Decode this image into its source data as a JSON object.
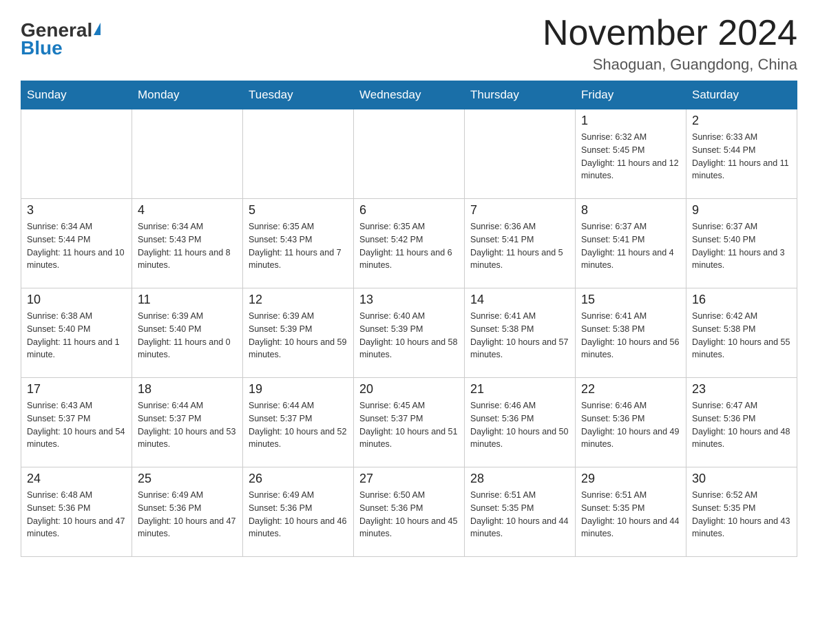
{
  "header": {
    "logo_general": "General",
    "logo_blue": "Blue",
    "month_title": "November 2024",
    "location": "Shaoguan, Guangdong, China"
  },
  "weekdays": [
    "Sunday",
    "Monday",
    "Tuesday",
    "Wednesday",
    "Thursday",
    "Friday",
    "Saturday"
  ],
  "weeks": [
    [
      {
        "day": "",
        "info": ""
      },
      {
        "day": "",
        "info": ""
      },
      {
        "day": "",
        "info": ""
      },
      {
        "day": "",
        "info": ""
      },
      {
        "day": "",
        "info": ""
      },
      {
        "day": "1",
        "info": "Sunrise: 6:32 AM\nSunset: 5:45 PM\nDaylight: 11 hours and 12 minutes."
      },
      {
        "day": "2",
        "info": "Sunrise: 6:33 AM\nSunset: 5:44 PM\nDaylight: 11 hours and 11 minutes."
      }
    ],
    [
      {
        "day": "3",
        "info": "Sunrise: 6:34 AM\nSunset: 5:44 PM\nDaylight: 11 hours and 10 minutes."
      },
      {
        "day": "4",
        "info": "Sunrise: 6:34 AM\nSunset: 5:43 PM\nDaylight: 11 hours and 8 minutes."
      },
      {
        "day": "5",
        "info": "Sunrise: 6:35 AM\nSunset: 5:43 PM\nDaylight: 11 hours and 7 minutes."
      },
      {
        "day": "6",
        "info": "Sunrise: 6:35 AM\nSunset: 5:42 PM\nDaylight: 11 hours and 6 minutes."
      },
      {
        "day": "7",
        "info": "Sunrise: 6:36 AM\nSunset: 5:41 PM\nDaylight: 11 hours and 5 minutes."
      },
      {
        "day": "8",
        "info": "Sunrise: 6:37 AM\nSunset: 5:41 PM\nDaylight: 11 hours and 4 minutes."
      },
      {
        "day": "9",
        "info": "Sunrise: 6:37 AM\nSunset: 5:40 PM\nDaylight: 11 hours and 3 minutes."
      }
    ],
    [
      {
        "day": "10",
        "info": "Sunrise: 6:38 AM\nSunset: 5:40 PM\nDaylight: 11 hours and 1 minute."
      },
      {
        "day": "11",
        "info": "Sunrise: 6:39 AM\nSunset: 5:40 PM\nDaylight: 11 hours and 0 minutes."
      },
      {
        "day": "12",
        "info": "Sunrise: 6:39 AM\nSunset: 5:39 PM\nDaylight: 10 hours and 59 minutes."
      },
      {
        "day": "13",
        "info": "Sunrise: 6:40 AM\nSunset: 5:39 PM\nDaylight: 10 hours and 58 minutes."
      },
      {
        "day": "14",
        "info": "Sunrise: 6:41 AM\nSunset: 5:38 PM\nDaylight: 10 hours and 57 minutes."
      },
      {
        "day": "15",
        "info": "Sunrise: 6:41 AM\nSunset: 5:38 PM\nDaylight: 10 hours and 56 minutes."
      },
      {
        "day": "16",
        "info": "Sunrise: 6:42 AM\nSunset: 5:38 PM\nDaylight: 10 hours and 55 minutes."
      }
    ],
    [
      {
        "day": "17",
        "info": "Sunrise: 6:43 AM\nSunset: 5:37 PM\nDaylight: 10 hours and 54 minutes."
      },
      {
        "day": "18",
        "info": "Sunrise: 6:44 AM\nSunset: 5:37 PM\nDaylight: 10 hours and 53 minutes."
      },
      {
        "day": "19",
        "info": "Sunrise: 6:44 AM\nSunset: 5:37 PM\nDaylight: 10 hours and 52 minutes."
      },
      {
        "day": "20",
        "info": "Sunrise: 6:45 AM\nSunset: 5:37 PM\nDaylight: 10 hours and 51 minutes."
      },
      {
        "day": "21",
        "info": "Sunrise: 6:46 AM\nSunset: 5:36 PM\nDaylight: 10 hours and 50 minutes."
      },
      {
        "day": "22",
        "info": "Sunrise: 6:46 AM\nSunset: 5:36 PM\nDaylight: 10 hours and 49 minutes."
      },
      {
        "day": "23",
        "info": "Sunrise: 6:47 AM\nSunset: 5:36 PM\nDaylight: 10 hours and 48 minutes."
      }
    ],
    [
      {
        "day": "24",
        "info": "Sunrise: 6:48 AM\nSunset: 5:36 PM\nDaylight: 10 hours and 47 minutes."
      },
      {
        "day": "25",
        "info": "Sunrise: 6:49 AM\nSunset: 5:36 PM\nDaylight: 10 hours and 47 minutes."
      },
      {
        "day": "26",
        "info": "Sunrise: 6:49 AM\nSunset: 5:36 PM\nDaylight: 10 hours and 46 minutes."
      },
      {
        "day": "27",
        "info": "Sunrise: 6:50 AM\nSunset: 5:36 PM\nDaylight: 10 hours and 45 minutes."
      },
      {
        "day": "28",
        "info": "Sunrise: 6:51 AM\nSunset: 5:35 PM\nDaylight: 10 hours and 44 minutes."
      },
      {
        "day": "29",
        "info": "Sunrise: 6:51 AM\nSunset: 5:35 PM\nDaylight: 10 hours and 44 minutes."
      },
      {
        "day": "30",
        "info": "Sunrise: 6:52 AM\nSunset: 5:35 PM\nDaylight: 10 hours and 43 minutes."
      }
    ]
  ]
}
